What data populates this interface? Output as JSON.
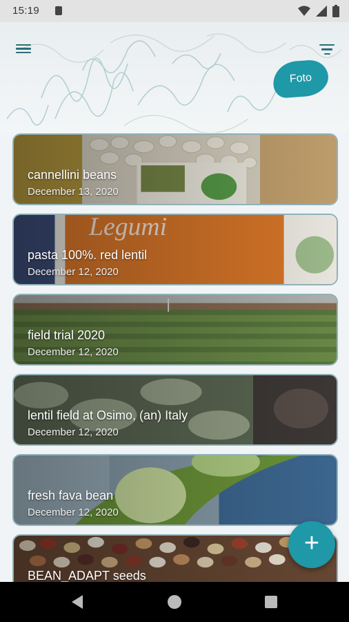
{
  "status_bar": {
    "time": "15:19"
  },
  "app_bar": {
    "foto_label": "Foto"
  },
  "cards": [
    {
      "title": "cannellini beans",
      "date": "December 13, 2020"
    },
    {
      "title": "pasta 100%. red lentil",
      "date": "December 12, 2020"
    },
    {
      "title": "field trial 2020",
      "date": "December 12, 2020"
    },
    {
      "title": "lentil field at Osimo, (an) Italy",
      "date": "December 12, 2020"
    },
    {
      "title": "fresh fava bean",
      "date": "December 12, 2020"
    },
    {
      "title": "BEAN_ADAPT seeds",
      "date": ""
    }
  ],
  "fab": {
    "label": "+"
  },
  "colors": {
    "accent": "#1f98a8",
    "icon": "#2b6f7a",
    "card_border": "#8fb2b8"
  }
}
